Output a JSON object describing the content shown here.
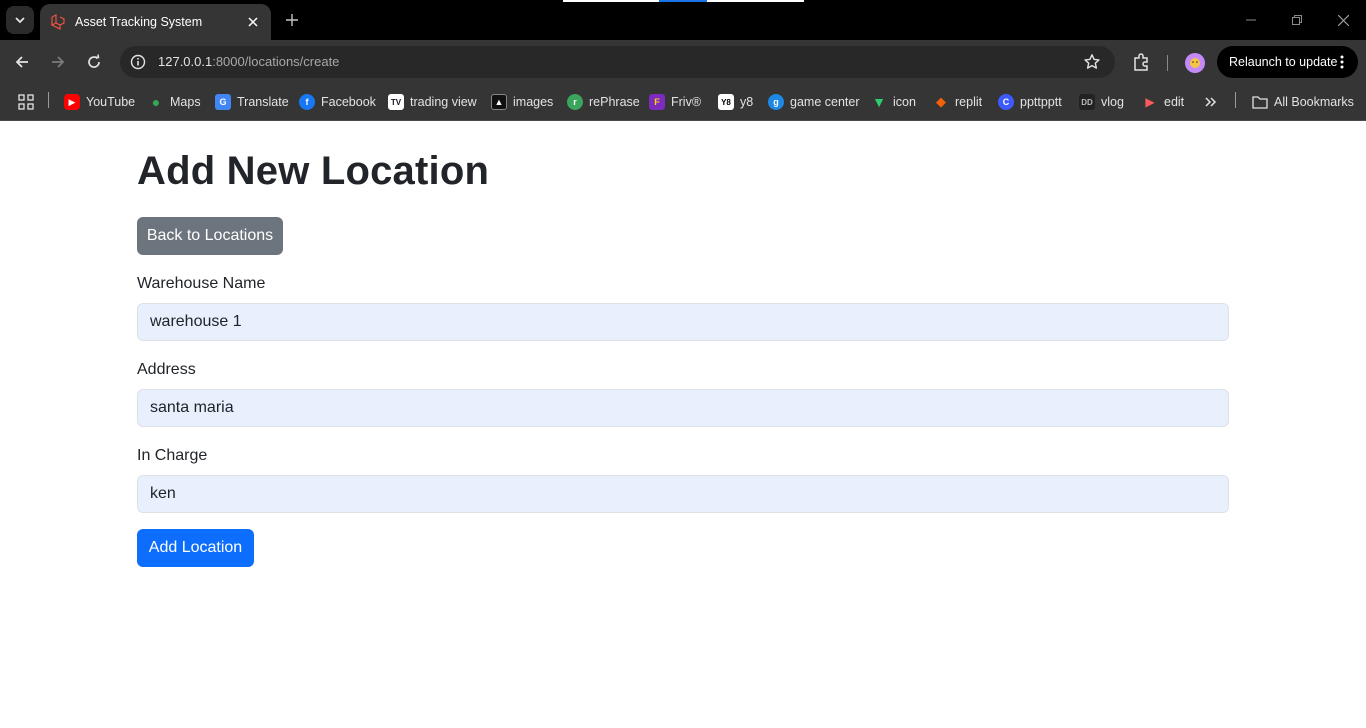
{
  "browser": {
    "tab": {
      "title": "Asset Tracking System"
    },
    "url": {
      "host": "127.0.0.1",
      "rest": ":8000/locations/create"
    },
    "relaunch_label": "Relaunch to update",
    "bookmarks": [
      {
        "label": "YouTube",
        "icon": "youtube-icon",
        "color": "#ff0000"
      },
      {
        "label": "Maps",
        "icon": "maps-icon",
        "color": "#34a853"
      },
      {
        "label": "Translate",
        "icon": "translate-icon",
        "color": "#4285f4"
      },
      {
        "label": "Facebook",
        "icon": "facebook-icon",
        "color": "#1877f2"
      },
      {
        "label": "trading view",
        "icon": "tradingview-icon",
        "color": "#131722"
      },
      {
        "label": "images",
        "icon": "images-icon",
        "color": "#111111"
      },
      {
        "label": "rePhrase",
        "icon": "rephrase-icon",
        "color": "#3ba55d"
      },
      {
        "label": "Friv®",
        "icon": "friv-icon",
        "color": "#7b2cbf"
      },
      {
        "label": "y8",
        "icon": "y8-icon",
        "color": "#ffffff"
      },
      {
        "label": "game center",
        "icon": "gamecenter-icon",
        "color": "#1e88e5"
      },
      {
        "label": "icon",
        "icon": "icon-icon",
        "color": "#2ecc71"
      },
      {
        "label": "replit",
        "icon": "replit-icon",
        "color": "#f26207"
      },
      {
        "label": "ppttpptt",
        "icon": "ppttpptt-icon",
        "color": "#3d5afe"
      },
      {
        "label": "vlog",
        "icon": "vlog-icon",
        "color": "#222222"
      },
      {
        "label": "edit",
        "icon": "edit-icon",
        "color": "#ff5a5f"
      }
    ],
    "all_bookmarks_label": "All Bookmarks"
  },
  "page": {
    "heading": "Add New Location",
    "back_button": "Back to Locations",
    "fields": [
      {
        "label": "Warehouse Name",
        "value": "warehouse 1"
      },
      {
        "label": "Address",
        "value": "santa maria"
      },
      {
        "label": "In Charge",
        "value": "ken"
      }
    ],
    "submit_button": "Add Location"
  },
  "colors": {
    "primary": "#0d6efd",
    "secondary": "#6c757d",
    "input_autofill": "#e8f0fe"
  }
}
